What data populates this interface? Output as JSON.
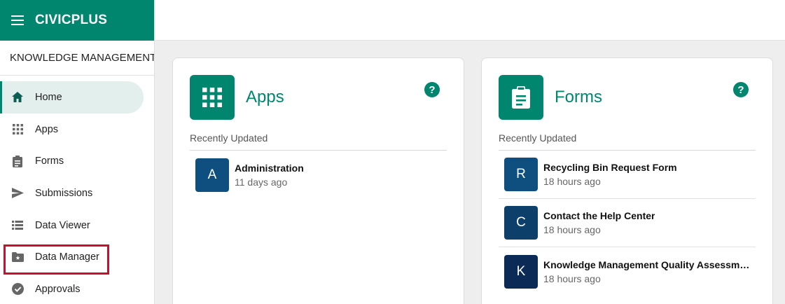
{
  "brand": {
    "name": "CIVICPLUS",
    "color": "#00856f"
  },
  "workspace": {
    "label": "KNOWLEDGE MANAGEMENT",
    "chevron": "›"
  },
  "nav": [
    {
      "label": "Home",
      "icon": "home-icon",
      "active": true
    },
    {
      "label": "Apps",
      "icon": "apps-grid-icon"
    },
    {
      "label": "Forms",
      "icon": "clipboard-icon"
    },
    {
      "label": "Submissions",
      "icon": "send-icon"
    },
    {
      "label": "Data Viewer",
      "icon": "list-view-icon"
    },
    {
      "label": "Data Manager",
      "icon": "folder-star-icon",
      "highlighted": true
    },
    {
      "label": "Approvals",
      "icon": "check-circle-icon"
    }
  ],
  "apps_card": {
    "title": "Apps",
    "section": "Recently Updated",
    "help": "?",
    "items": [
      {
        "initial": "A",
        "title": "Administration",
        "updated": "11 days ago",
        "color": "#0e4f7f"
      }
    ]
  },
  "forms_card": {
    "title": "Forms",
    "section": "Recently Updated",
    "help": "?",
    "items": [
      {
        "initial": "R",
        "title": "Recycling Bin Request Form",
        "updated": "18 hours ago",
        "color": "#0e4f7f"
      },
      {
        "initial": "C",
        "title": "Contact the Help Center",
        "updated": "18 hours ago",
        "color": "#0d3f6b"
      },
      {
        "initial": "K",
        "title": "Knowledge Management Quality Assessment…",
        "updated": "18 hours ago",
        "color": "#0b2a55"
      }
    ]
  }
}
